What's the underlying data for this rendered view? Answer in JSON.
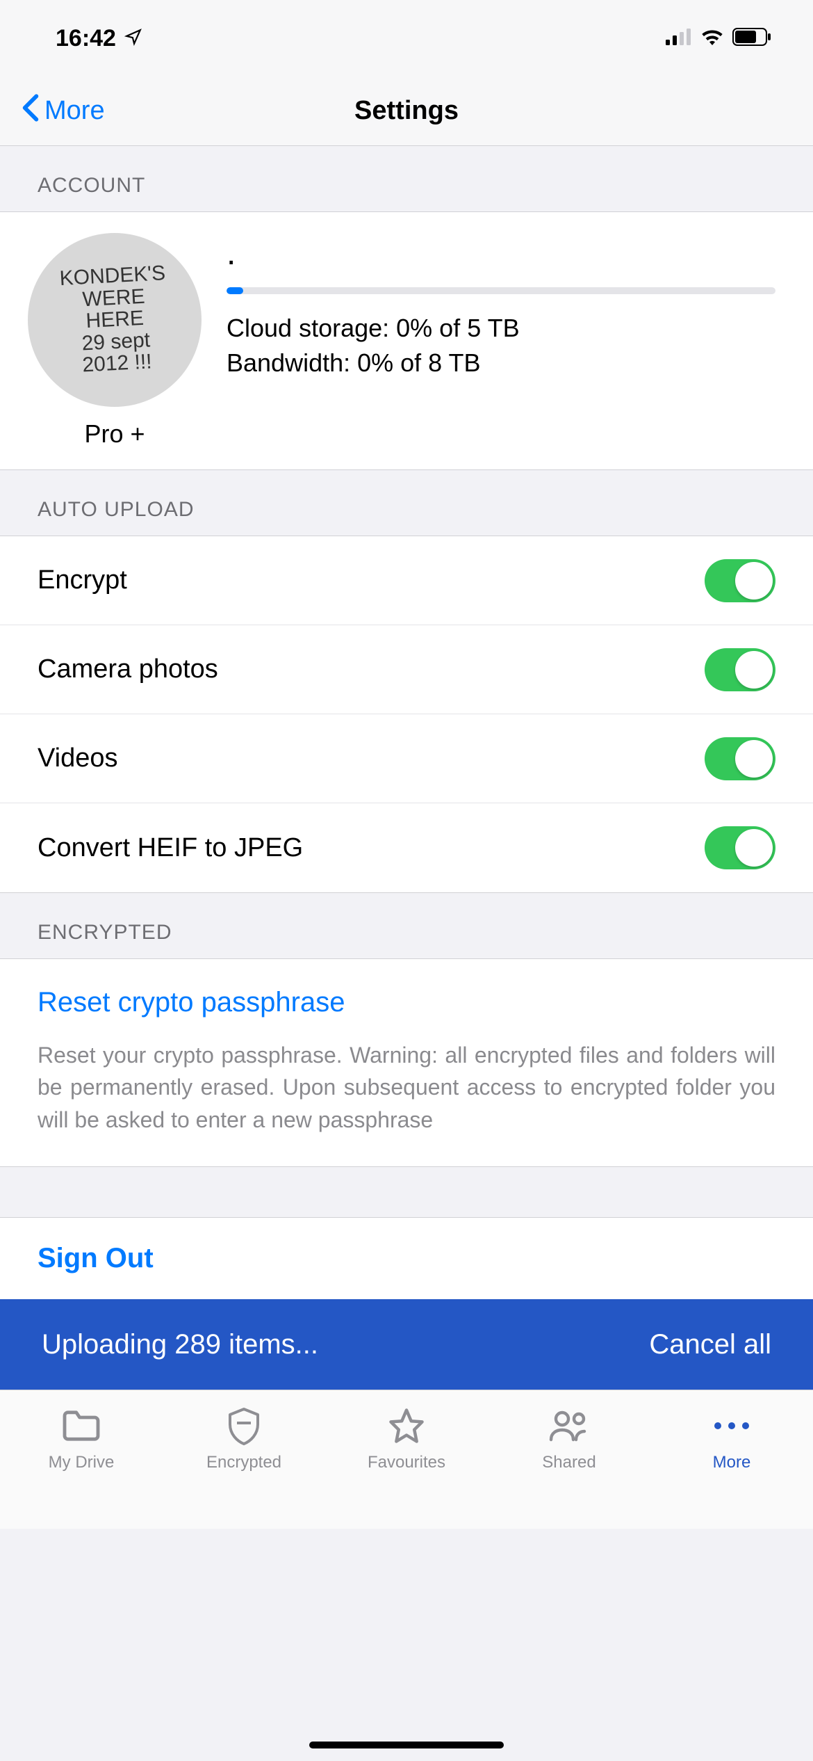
{
  "status": {
    "time": "16:42"
  },
  "nav": {
    "back_label": "More",
    "title": "Settings"
  },
  "sections": {
    "account_header": "ACCOUNT",
    "auto_upload_header": "AUTO UPLOAD",
    "encrypted_header": "ENCRYPTED"
  },
  "account": {
    "avatar_text": "KONDEK'S\nWERE\nHERE\n29 sept\n2012 !!!",
    "plan": "Pro +",
    "progress_percent": 3,
    "storage_line": "Cloud storage: 0% of 5 TB",
    "bandwidth_line": "Bandwidth: 0% of 8 TB"
  },
  "auto_upload": {
    "rows": [
      {
        "label": "Encrypt",
        "on": true
      },
      {
        "label": "Camera photos",
        "on": true
      },
      {
        "label": "Videos",
        "on": true
      },
      {
        "label": "Convert HEIF to JPEG",
        "on": true
      }
    ]
  },
  "encrypted": {
    "reset_label": "Reset crypto passphrase",
    "reset_desc": "Reset your crypto passphrase. Warning: all encrypted files and folders will be permanently erased. Upon subsequent access to encrypted folder you will be asked to enter a new passphrase"
  },
  "signout_label": "Sign Out",
  "upload_banner": {
    "status": "Uploading 289 items...",
    "cancel": "Cancel all"
  },
  "tabs": [
    {
      "label": "My Drive"
    },
    {
      "label": "Encrypted"
    },
    {
      "label": "Favourites"
    },
    {
      "label": "Shared"
    },
    {
      "label": "More"
    }
  ],
  "active_tab": 4,
  "colors": {
    "accent": "#007aff",
    "switch_on": "#34c759",
    "banner": "#2457c5"
  }
}
